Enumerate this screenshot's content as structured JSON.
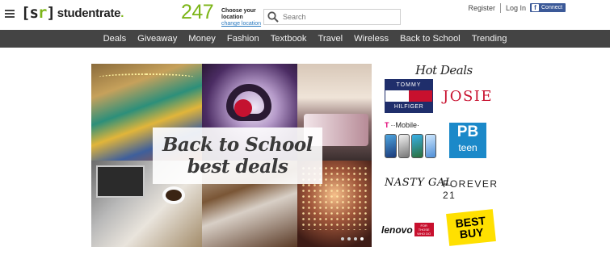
{
  "header": {
    "logo": {
      "bracket_open": "[s",
      "bracket_r": "r",
      "bracket_close": "]",
      "name": "studentrate",
      "dot": "."
    },
    "location": {
      "count": "247",
      "choose": "Choose your location",
      "change": "change location"
    },
    "search": {
      "placeholder": "Search"
    },
    "auth": {
      "register": "Register",
      "login": "Log In",
      "connect": "Connect",
      "fb_letter": "f"
    }
  },
  "nav": {
    "items": [
      "Deals",
      "Giveaway",
      "Money",
      "Fashion",
      "Textbook",
      "Travel",
      "Wireless",
      "Back to School",
      "Trending"
    ]
  },
  "hero": {
    "line1": "Back to School",
    "line2": "best deals"
  },
  "hot_deals": {
    "title": "Hot Deals",
    "tommy": {
      "top": "TOMMY",
      "bottom": "HILFIGER"
    },
    "josie": "JOSIE",
    "tmobile": {
      "t": "T",
      "label": "··Mobile·"
    },
    "pbteen": {
      "pb": "PB",
      "teen": "teen"
    },
    "nastygal": "NASTY GAL",
    "forever21": "FOREVER 21",
    "lenovo": {
      "name": "lenovo",
      "tag": "FOR THOSE WHO DO"
    },
    "bestbuy": {
      "line1": "BEST",
      "line2": "BUY"
    }
  },
  "colors": {
    "accent_green": "#7cb518",
    "nav_bg": "#444444",
    "facebook": "#3b5998",
    "link_blue": "#2a7ac0"
  }
}
